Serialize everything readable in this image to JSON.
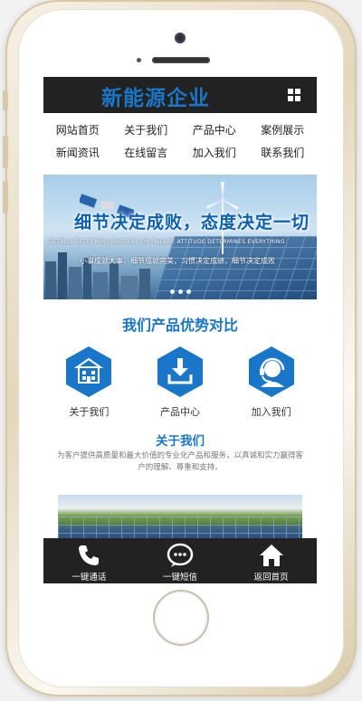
{
  "header": {
    "logo": "新能源企业",
    "menu_icon": "grid-menu-icon"
  },
  "nav": {
    "items": [
      {
        "label": "网站首页"
      },
      {
        "label": "关于我们"
      },
      {
        "label": "产品中心"
      },
      {
        "label": "案例展示"
      },
      {
        "label": "新闻资讯"
      },
      {
        "label": "在线留言"
      },
      {
        "label": "加入我们"
      },
      {
        "label": "联系我们"
      }
    ]
  },
  "banner": {
    "slogan": "细节决定成败，态度决定一切",
    "slogan_en": "DETAILS DETERMINE SUCCESS OR FAILURE ATTITUDE DETERMINES EVERYTHING",
    "sub": "小事成就大事，细节成就完美，习惯决定成绩，细节决定成败",
    "slides": 3
  },
  "products": {
    "title": "我们产品优势对比",
    "items": [
      {
        "label": "关于我们",
        "icon": "building-icon"
      },
      {
        "label": "产品中心",
        "icon": "download-icon"
      },
      {
        "label": "加入我们",
        "icon": "headset-icon"
      }
    ]
  },
  "about": {
    "title": "关于我们",
    "text": "为客户提供高质量和最大价值的专业化产品和服务，以真诚和实力赢得客户的理解、尊重和支持。"
  },
  "bottom_bar": {
    "items": [
      {
        "label": "一键通话",
        "icon": "phone-icon"
      },
      {
        "label": "一键短信",
        "icon": "message-icon"
      },
      {
        "label": "返回首页",
        "icon": "home-icon"
      }
    ]
  },
  "colors": {
    "accent": "#1976c8",
    "bar": "#222222"
  }
}
